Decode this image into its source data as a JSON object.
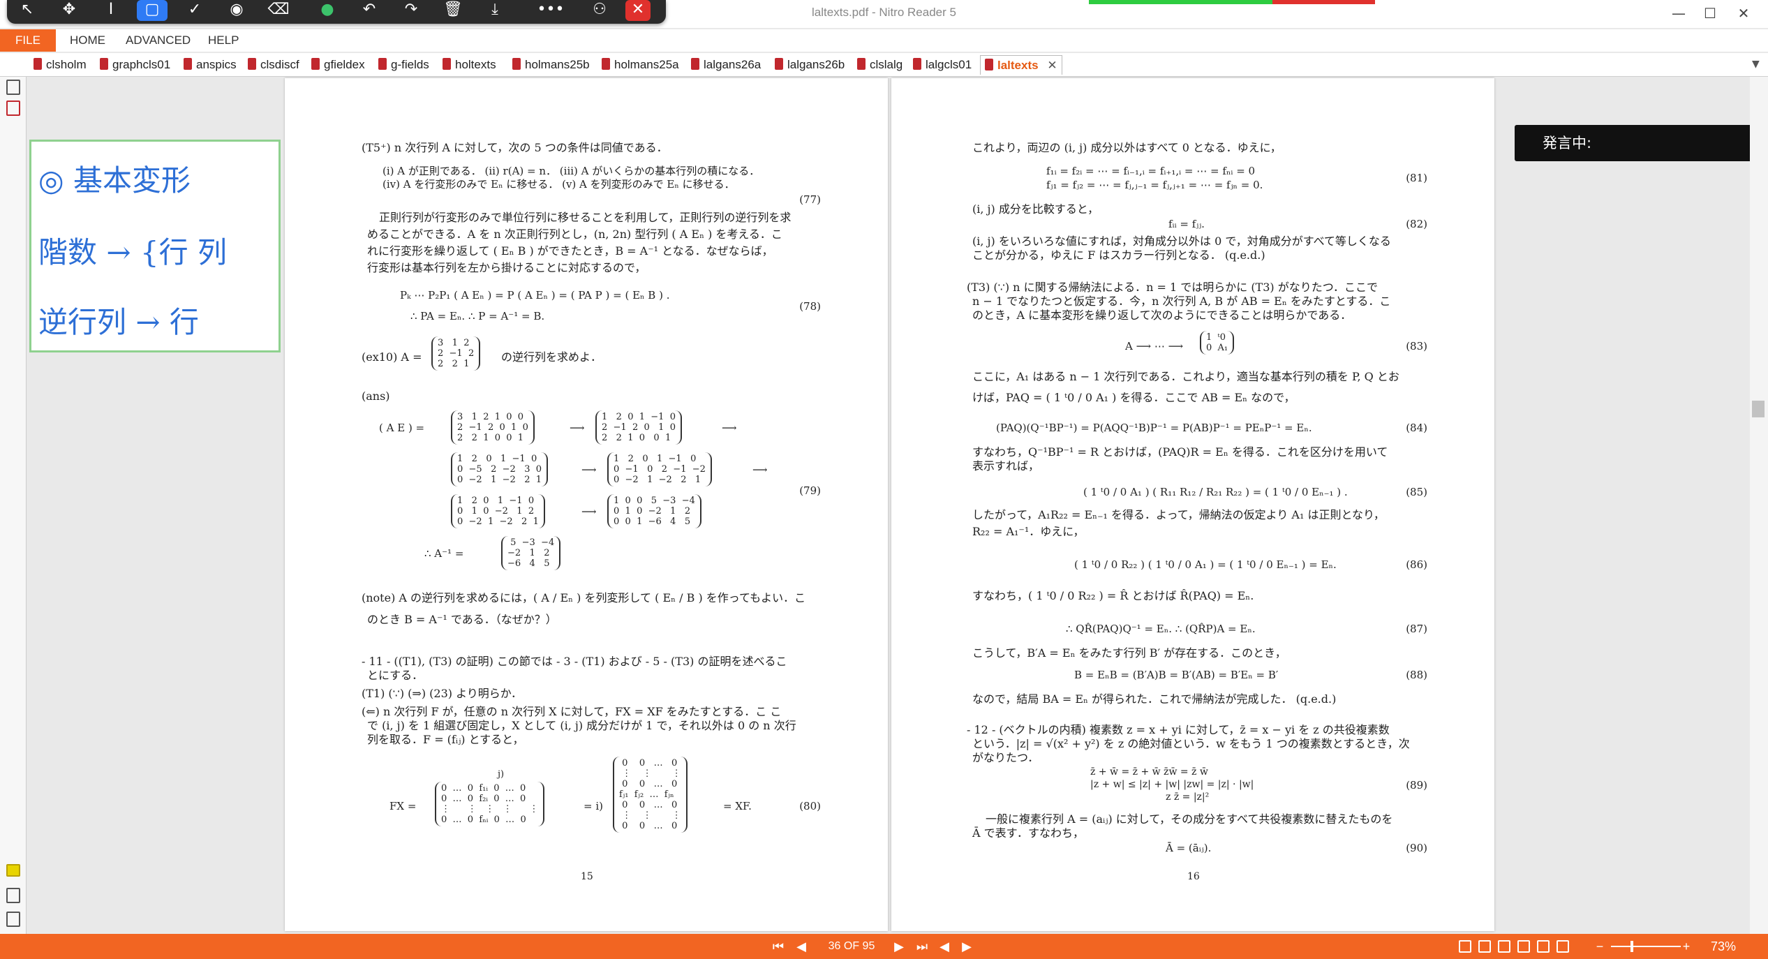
{
  "window": {
    "title": "laltexts.pdf - Nitro Reader 5",
    "minimize": "—",
    "maximize": "☐",
    "close": "✕"
  },
  "toolbar": {
    "select": "↖",
    "pan": "✥",
    "text": "Ⅰ",
    "rect": "▢",
    "check": "✓",
    "stamp": "◉",
    "eraser": "⌫",
    "dot": "●",
    "undo": "↶",
    "redo": "↷",
    "delete": "🗑",
    "download": "⤓",
    "more": "•••",
    "user": "⚇",
    "close": "✕"
  },
  "menu": {
    "file": "FILE",
    "home": "HOME",
    "advanced": "ADVANCED",
    "help": "HELP"
  },
  "tabs": [
    "clsholm",
    "graphcls01",
    "anspics",
    "clsdiscf",
    "gfieldex",
    "g-fields",
    "holtexts",
    "holmans25b",
    "holmans25a",
    "lalgans26a",
    "lalgans26b",
    "clslalg",
    "lalgcls01",
    "laltexts"
  ],
  "active_tab_close": "✕",
  "annotation": {
    "line1": "◎ 基本変形",
    "line2": "階数 → {行 列",
    "line3": "逆行列 → 行"
  },
  "speaking": "発言中:",
  "page15": {
    "l1": "(T5⁺) n 次行列 A に対して，次の 5 つの条件は同値である．",
    "l2": "(i) A が正則である．  (ii) r(A) = n．  (iii) A がいくらかの基本行列の積になる．",
    "l3": "(iv) A を行変形のみで Eₙ に移せる．  (v) A を列変形のみで Eₙ に移せる．",
    "n77": "(77)",
    "p1": "正則行列が行変形のみで単位行列に移せることを利用して，正則行列の逆行列を求",
    "p2": "めることができる．A を n 次正則行列とし，(n, 2n) 型行列 ( A  Eₙ ) を考える．こ",
    "p3": "れに行変形を繰り返して ( Eₙ  B ) ができたとき，B = A⁻¹ となる．なぜならば，",
    "p4": "行変形は基本行列を左から掛けることに対応するので，",
    "e78a": "Pₖ ⋯ P₂P₁ ( A  Eₙ ) = P ( A  Eₙ ) = ( PA  P ) = ( Eₙ  B ) .",
    "e78b": "∴ PA = Eₙ.     ∴ P = A⁻¹ = B.",
    "n78": "(78)",
    "ex10": "(ex10) A =",
    "ex10m": "3   1  2\n2  −1  2\n2   2  1",
    "ex10t": "の逆行列を求めよ．",
    "ans": "(ans)",
    "ae": "( A  E ) =",
    "m1": "3   1  2  1  0  0\n2  −1  2  0  1  0\n2   2  1  0  0  1",
    "m2": "1   2  0  1  −1  0\n2  −1  2  0   1  0\n2   2  1  0   0  1",
    "m3": "1   2   0   1  −1  0\n0  −5   2  −2   3  0\n0  −2   1  −2   2  1",
    "m4": "1   2   0   1  −1   0\n0  −1   0   2  −1  −2\n0  −2   1  −2   2   1",
    "m5": "1   2  0   1  −1  0\n0   1  0  −2   1  2\n0  −2  1  −2   2  1",
    "m6": "1  0  0   5  −3  −4\n0  1  0  −2   1   2\n0  0  1  −6   4   5",
    "arrow": "⟶",
    "n79": "(79)",
    "inv": "∴    A⁻¹ =",
    "invm": " 5  −3  −4\n−2   1   2\n−6   4   5",
    "note1": "(note) A の逆行列を求めるには，( A / Eₙ ) を列変形して ( Eₙ / B ) を作ってもよい．こ",
    "note2": "のとき B = A⁻¹ である．（なぜか？）",
    "s11a": "- 11 - ((T1), (T3) の証明) この節では - 3 - (T1) および - 5 - (T3) の証明を述べるこ",
    "s11b": "とにする．",
    "t1": "(T1) (∵) (⇒) (23) より明らか．",
    "c1": "(⇐) n 次行列 F が，任意の n 次行列 X に対して，FX = XF をみたすとする．こ こ",
    "c2": "で (i, j) を 1 組選び固定し，X として (i, j) 成分だけが 1 で，それ以外は 0 の n 次行",
    "c3": "列を取る．F = (fᵢⱼ) とすると，",
    "fx": "FX =",
    "mfx": "0  …  0  f₁ᵢ  0  …  0\n0  …  0  f₂ᵢ  0  …  0\n⋮      ⋮   ⋮   ⋮      ⋮\n0  …  0  fₙᵢ  0  …  0",
    "j": "j)",
    "eqi": "= i)",
    "mxf": " 0    0   …   0\n ⋮    ⋮       ⋮\n 0    0   …   0\nfⱼ₁  fⱼ₂  …  fⱼₙ\n 0    0   …   0\n ⋮    ⋮       ⋮\n 0    0   …   0",
    "xf": "= XF.",
    "n80": "(80)",
    "pnum": "15"
  },
  "page16": {
    "a1": "これより，両辺の (i, j) 成分以外はすべて 0 となる．ゆえに，",
    "e81a": "f₁ᵢ = f₂ᵢ = ⋯ = fᵢ₋₁,ᵢ = fᵢ₊₁,ᵢ = ⋯ = fₙᵢ = 0",
    "e81b": "fⱼ₁ = fⱼ₂ = ⋯ = fⱼ,ⱼ₋₁ = fⱼ,ⱼ₊₁ = ⋯ = fⱼₙ = 0.",
    "n81": "(81)",
    "a2": "(i, j) 成分を比較すると，",
    "e82": "fᵢᵢ = fⱼⱼ.",
    "n82": "(82)",
    "a3": "(i, j) をいろいろな値にすれば，対角成分以外は 0 で，対角成分がすべて等しくなる",
    "a4": "ことが分かる，ゆえに F はスカラー行列となる．  (q.e.d.)",
    "t3a": "(T3) (∵) n に関する帰納法による．n = 1 では明らかに (T3) がなりたつ．ここで",
    "t3b": "n − 1 でなりたつと仮定する．今，n 次行列 A, B が AB = Eₙ をみたすとする．こ",
    "t3c": "のとき，A に基本変形を繰り返して次のようにできることは明らかである．",
    "e83": "A ⟶ ⋯ ⟶",
    "m83": "1  ᵗ0\n0  A₁",
    "n83": "(83)",
    "b1": "ここに，A₁ はある n − 1 次行列である．これより，適当な基本行列の積を P, Q とお",
    "b2": "けば，PAQ = ( 1 ᵗ0 / 0 A₁ ) を得る．ここで AB = Eₙ なので，",
    "e84": "(PAQ)(Q⁻¹BP⁻¹) = P(AQQ⁻¹B)P⁻¹ = P(AB)P⁻¹ = PEₙP⁻¹ = Eₙ.",
    "n84": "(84)",
    "c1": "すなわち，Q⁻¹BP⁻¹ = R とおけば，(PAQ)R = Eₙ を得る．これを区分けを用いて",
    "c2": "表示すれば，",
    "e85": "( 1  ᵗ0 / 0  A₁ ) ( R₁₁  R₁₂ / R₂₁  R₂₂ ) = ( 1  ᵗ0 / 0  Eₙ₋₁ ) .",
    "n85": "(85)",
    "d1": "したがって，A₁R₂₂ = Eₙ₋₁ を得る．よって，帰納法の仮定より A₁ は正則となり，",
    "d2": "R₂₂ = A₁⁻¹．ゆえに，",
    "e86": "( 1  ᵗ0 / 0  R₂₂ ) ( 1  ᵗ0 / 0  A₁ ) = ( 1  ᵗ0 / 0  Eₙ₋₁ ) = Eₙ.",
    "n86": "(86)",
    "e1": "すなわち，( 1 ᵗ0 / 0 R₂₂ ) = R̂ とおけば R̂(PAQ) = Eₙ.",
    "e87": "∴ QR̂(PAQ)Q⁻¹ = Eₙ.     ∴ (QR̂P)A = Eₙ.",
    "n87": "(87)",
    "f1": "こうして，B′A = Eₙ をみたす行列 B′ が存在する．このとき，",
    "e88": "B = EₙB = (B′A)B = B′(AB) = B′Eₙ = B′",
    "n88": "(88)",
    "g1": "なので，結局 BA = Eₙ が得られた．これで帰納法が完成した．  (q.e.d.)",
    "h1": "- 12 - (ベクトルの内積) 複素数 z = x + yi に対して，z̄ = x − yi を z の共役複素数",
    "h2": "という．|z| = √(x² + y²) を z の絶対値という．w をもう 1 つの複素数とするとき，次",
    "h3": "がなりたつ．",
    "e89a": "z̄ + w̄ = z̄ + w̄              z̄w̄ = z̄ w̄",
    "e89b": "|z + w| ≤ |z| + |w|          |zw| = |z| · |w|",
    "e89c": "z z̄ = |z|²",
    "n89": "(89)",
    "i1": "一般に複素行列 A = (aᵢⱼ) に対して，その成分をすべて共役複素数に替えたものを",
    "i2": "Ā で表す．すなわち，",
    "e90": "Ā = (āᵢⱼ).",
    "n90": "(90)",
    "pnum": "16"
  },
  "status": {
    "first": "⏮",
    "prev": "◀",
    "page": "36 OF 95",
    "next": "▶",
    "last": "⏭",
    "back": "◀",
    "fwd": "▶",
    "zoom": "73%",
    "minus": "−",
    "plus": "+"
  }
}
